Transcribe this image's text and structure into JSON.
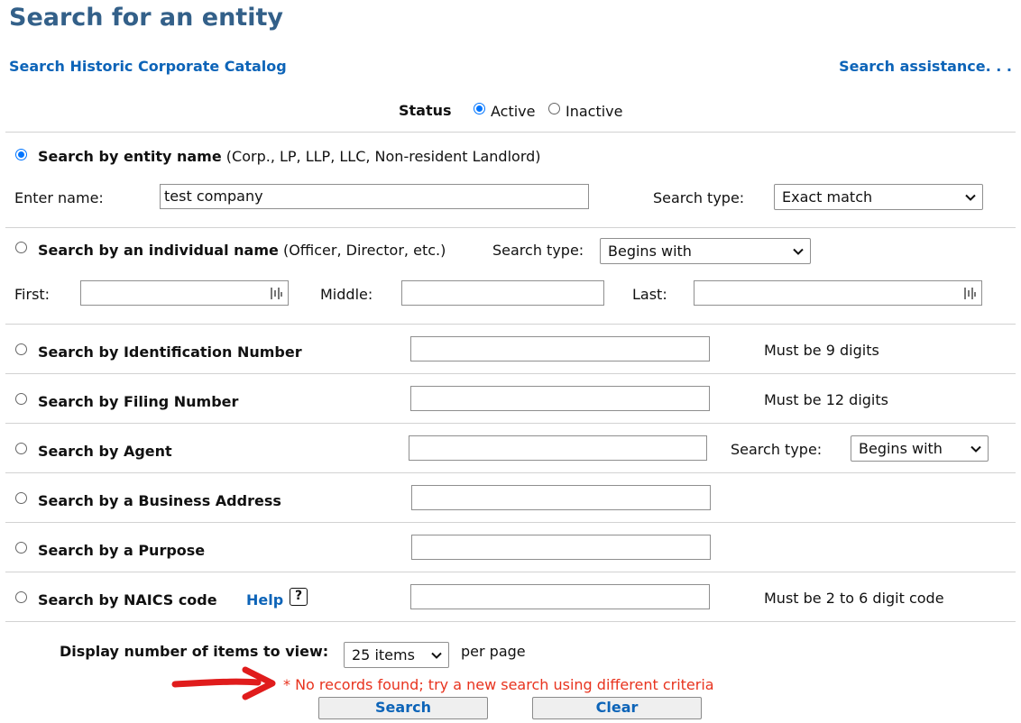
{
  "page": {
    "title": "Search for an entity",
    "historic_link": "Search Historic Corporate Catalog",
    "assistance_link": "Search assistance. . ."
  },
  "status": {
    "label": "Status",
    "options": [
      "Active",
      "Inactive"
    ],
    "selected": "Active"
  },
  "entity": {
    "label": "Search by entity name",
    "hint": "(Corp., LP, LLP, LLC, Non-resident Landlord)",
    "name_label": "Enter name:",
    "name_value": "test company",
    "search_type_label": "Search type:",
    "search_type_value": "Exact match"
  },
  "individual": {
    "label": "Search by an individual name",
    "hint": "(Officer, Director, etc.)",
    "search_type_label": "Search type:",
    "search_type_value": "Begins with",
    "first_label": "First:",
    "middle_label": "Middle:",
    "last_label": "Last:",
    "first_value": "",
    "middle_value": "",
    "last_value": ""
  },
  "id_number": {
    "label": "Search by Identification Number",
    "note": "Must be 9 digits",
    "value": ""
  },
  "filing_number": {
    "label": "Search by Filing Number",
    "note": "Must be 12 digits",
    "value": ""
  },
  "agent": {
    "label": "Search by Agent",
    "search_type_label": "Search type:",
    "search_type_value": "Begins with",
    "value": ""
  },
  "business_address": {
    "label": "Search by a Business Address",
    "value": ""
  },
  "purpose": {
    "label": "Search by a Purpose",
    "value": ""
  },
  "naics": {
    "label": "Search by NAICS code",
    "help_label": "Help",
    "help_icon": "?",
    "note": "Must be 2 to 6 digit code",
    "value": ""
  },
  "display": {
    "label": "Display number of items to view:",
    "value": "25 items",
    "suffix": "per page"
  },
  "error_message": "* No records found; try a new search using different criteria",
  "buttons": {
    "search": "Search",
    "clear": "Clear"
  },
  "colors": {
    "title": "#336089",
    "link": "#0d64b8",
    "error": "#e8331e",
    "arrow": "#e01c1c",
    "radio": "#0075ff"
  }
}
